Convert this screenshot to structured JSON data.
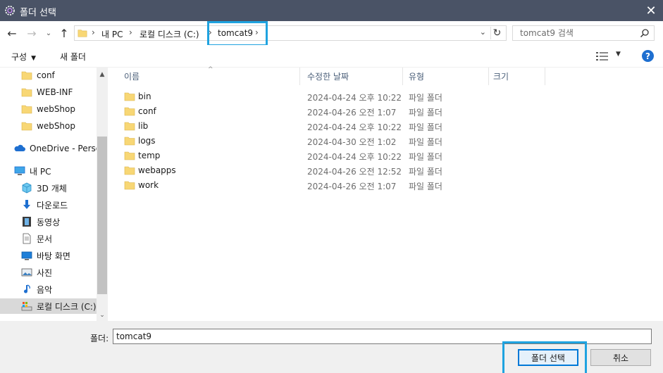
{
  "window": {
    "title": "폴더 선택",
    "close_glyph": "✕"
  },
  "nav": {
    "back_glyph": "←",
    "forward_glyph": "→",
    "recent_glyph": "⌄",
    "up_glyph": "↑"
  },
  "address": {
    "sep1": "›",
    "crumb_pc": "내 PC",
    "sep2": "›",
    "crumb_drive": "로컬 디스크 (C:)",
    "sep3": "›",
    "crumb_current": "tomcat9",
    "sep4": "›",
    "dropdown_glyph": "⌄",
    "refresh_glyph": "↻"
  },
  "search": {
    "placeholder": "tomcat9 검색"
  },
  "toolbar": {
    "organize_label": "구성",
    "organize_caret": "▼",
    "new_folder_label": "새 폴더",
    "view_caret": "▼",
    "help_label": "?"
  },
  "sidebar": {
    "items": [
      {
        "label": "conf",
        "icon": "folder-icon"
      },
      {
        "label": "WEB-INF",
        "icon": "folder-icon"
      },
      {
        "label": "webShop",
        "icon": "folder-icon"
      },
      {
        "label": "webShop",
        "icon": "folder-icon"
      },
      {
        "label": "OneDrive - Person",
        "icon": "onedrive-icon"
      },
      {
        "label": "내 PC",
        "icon": "pc-icon"
      },
      {
        "label": "3D 개체",
        "icon": "cube-icon"
      },
      {
        "label": "다운로드",
        "icon": "download-icon"
      },
      {
        "label": "동영상",
        "icon": "video-icon"
      },
      {
        "label": "문서",
        "icon": "document-icon"
      },
      {
        "label": "바탕 화면",
        "icon": "desktop-icon"
      },
      {
        "label": "사진",
        "icon": "picture-icon"
      },
      {
        "label": "음악",
        "icon": "music-icon"
      },
      {
        "label": "로컬 디스크 (C:)",
        "icon": "drive-icon"
      }
    ],
    "scroll_up_glyph": "▲",
    "scroll_down_glyph": "⌄"
  },
  "columns": {
    "name": "이름",
    "sort_glyph": "^",
    "modified": "수정한 날짜",
    "type": "유형",
    "size": "크기"
  },
  "files": [
    {
      "name": "bin",
      "modified": "2024-04-24 오후 10:22",
      "type": "파일 폴더"
    },
    {
      "name": "conf",
      "modified": "2024-04-26 오전 1:07",
      "type": "파일 폴더"
    },
    {
      "name": "lib",
      "modified": "2024-04-24 오후 10:22",
      "type": "파일 폴더"
    },
    {
      "name": "logs",
      "modified": "2024-04-30 오전 1:02",
      "type": "파일 폴더"
    },
    {
      "name": "temp",
      "modified": "2024-04-24 오후 10:22",
      "type": "파일 폴더"
    },
    {
      "name": "webapps",
      "modified": "2024-04-26 오전 12:52",
      "type": "파일 폴더"
    },
    {
      "name": "work",
      "modified": "2024-04-26 오전 1:07",
      "type": "파일 폴더"
    }
  ],
  "footer": {
    "folder_label": "폴더:",
    "folder_value": "tomcat9",
    "select_button": "폴더 선택",
    "cancel_button": "취소"
  },
  "colors": {
    "titlebar": "#4a5366",
    "highlight": "#1fa3e0",
    "folder": "#f8d775",
    "accent": "#0078d7"
  }
}
